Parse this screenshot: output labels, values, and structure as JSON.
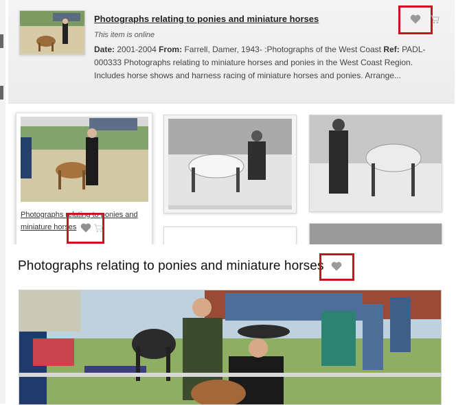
{
  "top_result": {
    "title": "Photographs relating to ponies and miniature horses",
    "status": "This item is online",
    "date_label": "Date:",
    "date_value": "2001-2004",
    "from_label": "From:",
    "from_value": "Farrell, Damer, 1943- :Photographs of the West Coast",
    "ref_label": "Ref:",
    "ref_value": "PADL-000333 Photographs relating to miniature horses and ponies in the West Coast Region. Includes horse shows and harness racing of miniature horses and ponies. Arrange..."
  },
  "grid_card": {
    "caption": "Photographs relating to ponies and miniature horses"
  },
  "detail": {
    "title": "Photographs relating to ponies and miniature horses"
  },
  "icons": {
    "favourite": "heart-icon",
    "cart": "cart-icon"
  },
  "colors": {
    "highlight_box": "#c8141e",
    "heart": "#9a9a9a"
  }
}
